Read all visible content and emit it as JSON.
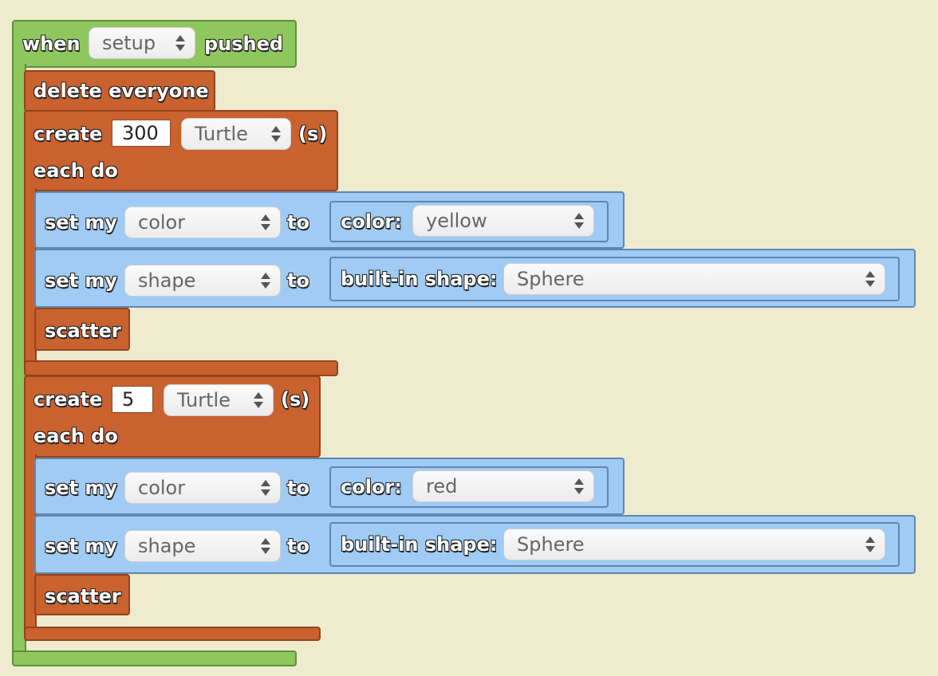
{
  "event": {
    "when": "when",
    "trigger": "setup",
    "pushed": "pushed"
  },
  "stmt_delete": "delete everyone",
  "create_blocks": [
    {
      "create": "create",
      "count": "300",
      "breed": "Turtle",
      "suffix": "(s)",
      "each_do": "each do",
      "set_color": {
        "set_my": "set my",
        "property": "color",
        "to": "to",
        "value_label": "color:",
        "value": "yellow"
      },
      "set_shape": {
        "set_my": "set my",
        "property": "shape",
        "to": "to",
        "value_label": "built-in shape:",
        "value": "Sphere"
      },
      "scatter": "scatter"
    },
    {
      "create": "create",
      "count": "5",
      "breed": "Turtle",
      "suffix": "(s)",
      "each_do": "each do",
      "set_color": {
        "set_my": "set my",
        "property": "color",
        "to": "to",
        "value_label": "color:",
        "value": "red"
      },
      "set_shape": {
        "set_my": "set my",
        "property": "shape",
        "to": "to",
        "value_label": "built-in shape:",
        "value": "Sphere"
      },
      "scatter": "scatter"
    }
  ],
  "colors": {
    "background": "#efebcf",
    "event_block": "#8fc75f",
    "action_block": "#c9622f",
    "property_block": "#9fcbf4"
  },
  "icons": {
    "dropdown": "updown-arrows-icon"
  }
}
